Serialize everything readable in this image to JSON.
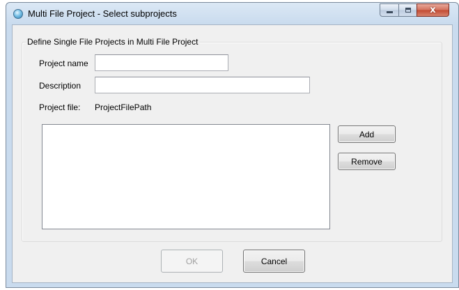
{
  "window": {
    "title": "Multi File Project - Select subprojects",
    "controls": {
      "minimize": "minimize",
      "maximize": "maximize",
      "close": "x"
    }
  },
  "group": {
    "title": "Define Single File Projects in Multi File Project"
  },
  "form": {
    "project_name_label": "Project name",
    "project_name_value": "",
    "description_label": "Description",
    "description_value": "",
    "project_file_label": "Project file:",
    "project_file_value": "ProjectFilePath"
  },
  "subprojects": {
    "items": []
  },
  "buttons": {
    "add": "Add",
    "remove": "Remove",
    "ok": "OK",
    "cancel": "Cancel"
  },
  "colors": {
    "titlebar": "#c9dbee",
    "client_background": "#f0f0f0",
    "close_button": "#c24a32"
  }
}
